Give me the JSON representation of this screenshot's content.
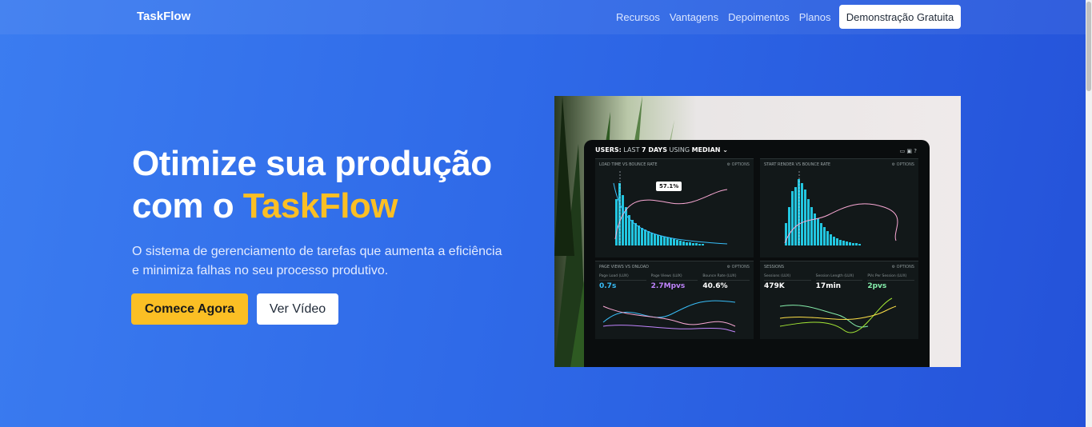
{
  "nav": {
    "brand": "TaskFlow",
    "links": [
      "Recursos",
      "Vantagens",
      "Depoimentos",
      "Planos"
    ],
    "cta": "Demonstração Gratuita"
  },
  "hero": {
    "headline_line1": "Otimize sua produção",
    "headline_prefix": "com o ",
    "headline_accent": "TaskFlow",
    "subtitle": "O sistema de gerenciamento de tarefas que aumenta a eficiência e minimiza falhas no seu processo produtivo.",
    "primary_button": "Comece Agora",
    "secondary_button": "Ver Vídeo"
  },
  "dashboard": {
    "title_prefix": "USERS:",
    "title_mid": " LAST ",
    "title_days": "7 DAYS",
    "title_using": " USING ",
    "title_median": "MEDIAN",
    "panel1_title": "LOAD TIME VS BOUNCE RATE",
    "panel2_title": "START RENDER VS BOUNCE RATE",
    "panel3_title": "PAGE VIEWS VS ONLOAD",
    "panel4_title": "SESSIONS",
    "options_label": "OPTIONS",
    "tooltip_value": "57.1%",
    "metrics_left": [
      {
        "label": "Page Load (LUX)",
        "value": "0.7s",
        "color": "#38bdf8"
      },
      {
        "label": "Page Views (LUX)",
        "value": "2.7Mpvs",
        "color": "#c084fc"
      },
      {
        "label": "Bounce Rate (LUX)",
        "value": "40.6%",
        "color": "#ffffff"
      }
    ],
    "metrics_right": [
      {
        "label": "Sessions (LUX)",
        "value": "479K",
        "color": "#ffffff"
      },
      {
        "label": "Session Length (LUX)",
        "value": "17min",
        "color": "#ffffff"
      },
      {
        "label": "PVs Per Session (LUX)",
        "value": "2pvs",
        "color": "#86efac"
      }
    ]
  },
  "colors": {
    "accent": "#fbbf24",
    "background": "#2f6ae8",
    "bar": "#22c6e0"
  }
}
